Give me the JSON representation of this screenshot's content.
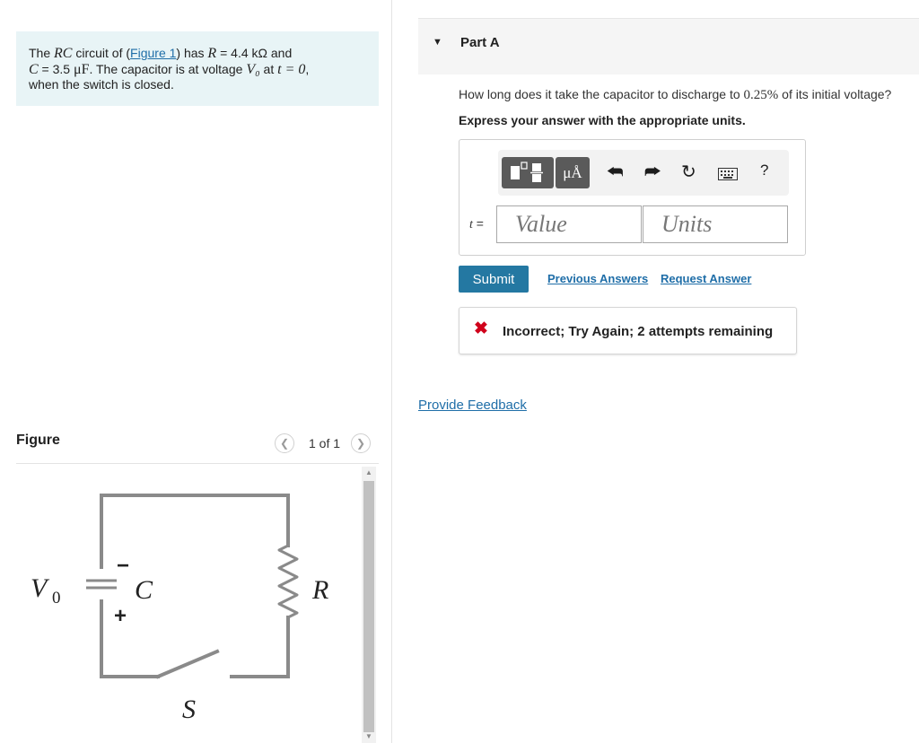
{
  "problem": {
    "text_part1": "The ",
    "rc_symbol": "RC",
    "text_part2": " circuit of (",
    "figure_link": "Figure 1",
    "text_part3": ") has ",
    "r_symbol": "R",
    "r_value": " = 4.4 kΩ",
    "text_part4": " and",
    "c_symbol": "C",
    "c_value": " = 3.5 ",
    "c_unit": "μF",
    "text_part5": ". The capacitor is at voltage ",
    "v0_symbol": "V₀",
    "text_part6": " at ",
    "t_expr": "t = 0",
    "text_part7": ",",
    "text_part8": "when the switch is closed."
  },
  "figure": {
    "title": "Figure",
    "prev_icon": "chevron-left-icon",
    "next_icon": "chevron-right-icon",
    "counter": "1 of 1",
    "labels": {
      "voltage": "V",
      "voltage_sub": "0",
      "capacitor": "C",
      "resistor": "R",
      "switch": "S",
      "minus": "−",
      "plus": "+"
    }
  },
  "part": {
    "title": "Part A",
    "question_part1": "How long does it take the capacitor to discharge to ",
    "question_percent": "0.25%",
    "question_part2": " of its initial voltage?",
    "instruction": "Express your answer with the appropriate units.",
    "toolbar": {
      "templates_icon": "templates-icon",
      "units_button": "μÅ",
      "undo_icon": "undo-icon",
      "redo_icon": "redo-icon",
      "reset_icon": "reset-icon",
      "keyboard_icon": "keyboard-icon",
      "help": "?"
    },
    "variable_label": "t",
    "equals": " =",
    "value_placeholder": "Value",
    "units_placeholder": "Units",
    "submit_label": "Submit",
    "previous_answers": "Previous Answers",
    "request_answer": "Request Answer",
    "feedback": "Incorrect; Try Again; 2 attempts remaining",
    "feedback_icon": "x-icon"
  },
  "provide_feedback": "Provide Feedback",
  "colors": {
    "accent": "#2478a2",
    "link": "#1f6ea8",
    "error": "#d0021b",
    "problem_bg": "#e8f4f6"
  }
}
